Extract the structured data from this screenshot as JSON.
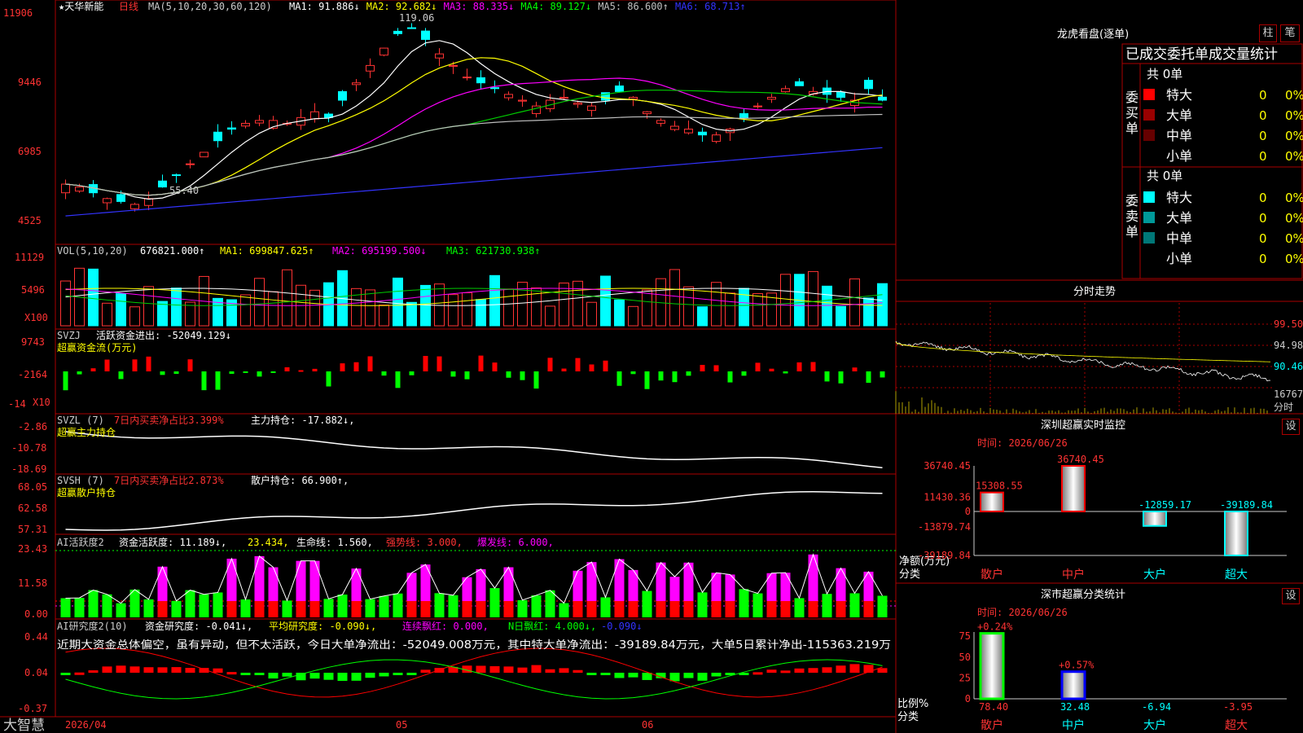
{
  "main": {
    "title": "★天华新能",
    "period": "日线",
    "ma_title": "MA(5,10,20,30,60,120)",
    "ma_values": [
      {
        "label": "MA1: 91.886↓",
        "color": "#ffffff"
      },
      {
        "label": "MA2: 92.682↓",
        "color": "#ffff00"
      },
      {
        "label": "MA3: 88.335↓",
        "color": "#ff00ff"
      },
      {
        "label": "MA4: 89.127↓",
        "color": "#00ff00"
      },
      {
        "label": "MA5: 86.600↑",
        "color": "#c0c0c0"
      },
      {
        "label": "MA6: 68.713↑",
        "color": "#3333ff"
      }
    ],
    "y_labels": [
      "11906",
      "9446",
      "6985",
      "4525"
    ],
    "high_label": "119.06",
    "low_label": "55.40"
  },
  "vol": {
    "title": "VOL(5,10,20)",
    "value": "676821.000↑",
    "ma1": "MA1: 699847.625↑",
    "ma2": "MA2: 695199.500↓",
    "ma3": "MA3: 621730.938↑",
    "y_labels": [
      "11129",
      "5496"
    ],
    "unit": "X100"
  },
  "svzj": {
    "title": "SVZJ",
    "desc": "活跃资金进出: -52049.129↓",
    "sub": "超赢资金流(万元)",
    "y_labels": [
      "9743",
      "-2164",
      "-14"
    ],
    "unit": "X10"
  },
  "svzl": {
    "title": "SVZL (7)",
    "desc": "7日内买卖净占比3.399%",
    "desc2": "主力持仓: -17.882↓,",
    "sub": "超赢主力持仓",
    "y_labels": [
      "-2.86",
      "-10.78",
      "-18.69"
    ]
  },
  "svsh": {
    "title": "SVSH (7)",
    "desc": "7日内买卖净占比2.873%",
    "desc2": "散户持仓: 66.900↑,",
    "sub": "超赢散户持仓",
    "y_labels": [
      "68.05",
      "62.58",
      "57.31"
    ]
  },
  "ai1": {
    "title": "AI活跃度2",
    "desc": "资金活跃度: 11.189↓,",
    "v2": "23.434,",
    "v3": "生命线: 1.560,",
    "v4": "强势线: 3.000,",
    "v5": "爆发线: 6.000,",
    "y_labels": [
      "23.43",
      "11.58",
      "0.00"
    ]
  },
  "ai2": {
    "title": "AI研究度2(10)",
    "desc": "资金研究度: -0.041↓,",
    "v2": "平均研究度: -0.090↓,",
    "v3": "连续飘红: 0.000,",
    "v4": "N日飘红: 4.000↓,",
    "v5": "-0.090↓",
    "comment": "近期大资金总体偏空，虽有异动，但不太活跃，今日大单净流出：-52049.008万元，其中特大单净流出：-39189.84万元，大单5日累计净出-115363.219万",
    "y_labels": [
      "0.44",
      "0.04",
      "-0.37"
    ]
  },
  "xaxis": {
    "brand": "大智慧",
    "labels": [
      "2026/04",
      "05",
      "06"
    ]
  },
  "longhu": {
    "title": "龙虎看盘(逐单)",
    "btn1": "柱",
    "btn2": "笔",
    "header": "已成交委托单成交量统计",
    "buy_label": "委买单",
    "sell_label": "委卖单",
    "buy_total": "共 0单",
    "sell_total": "共 0单",
    "buy_rows": [
      {
        "name": "特大",
        "count": "0",
        "pct": "0%",
        "color": "#ff0000"
      },
      {
        "name": "大单",
        "count": "0",
        "pct": "0%",
        "color": "#990000"
      },
      {
        "name": "中单",
        "count": "0",
        "pct": "0%",
        "color": "#660000"
      },
      {
        "name": "小单",
        "count": "0",
        "pct": "0%",
        "color": ""
      }
    ],
    "sell_rows": [
      {
        "name": "特大",
        "count": "0",
        "pct": "0%",
        "color": "#00ffff"
      },
      {
        "name": "大单",
        "count": "0",
        "pct": "0%",
        "color": "#009999"
      },
      {
        "name": "中单",
        "count": "0",
        "pct": "0%",
        "color": "#007777"
      },
      {
        "name": "小单",
        "count": "0",
        "pct": "0%",
        "color": ""
      }
    ]
  },
  "fenshi": {
    "title": "分时走势",
    "y_labels": [
      "99.50",
      "94.98",
      "90.46",
      "16767"
    ],
    "unit": "分时"
  },
  "monitor": {
    "title": "深圳超赢实时监控",
    "btn": "设",
    "time": "时间: 2026/06/26",
    "y_labels": [
      "36740.45",
      "11430.36",
      "0",
      "-13879.74",
      "-39189.84"
    ],
    "unit1": "净额(万元)",
    "unit2": "分类",
    "categories": [
      "散户",
      "中户",
      "大户",
      "超大"
    ],
    "values": [
      15308.55,
      36740.45,
      -12859.17,
      -39189.84
    ],
    "value_labels": [
      "15308.55",
      "36740.45",
      "-12859.17",
      "-39189.84"
    ]
  },
  "classify": {
    "title": "深市超赢分类统计",
    "btn": "设",
    "time": "时间: 2026/06/26",
    "y_labels": [
      "75",
      "50",
      "25",
      "0"
    ],
    "unit1": "比例%",
    "unit2": "分类",
    "categories": [
      "散户",
      "中户",
      "大户",
      "超大"
    ],
    "values": [
      78.4,
      32.48,
      -6.94,
      -3.95
    ],
    "value_labels": [
      "78.40",
      "32.48",
      "-6.94",
      "-3.95"
    ],
    "change_labels": [
      "+0.24%",
      "+0.57%"
    ]
  }
}
